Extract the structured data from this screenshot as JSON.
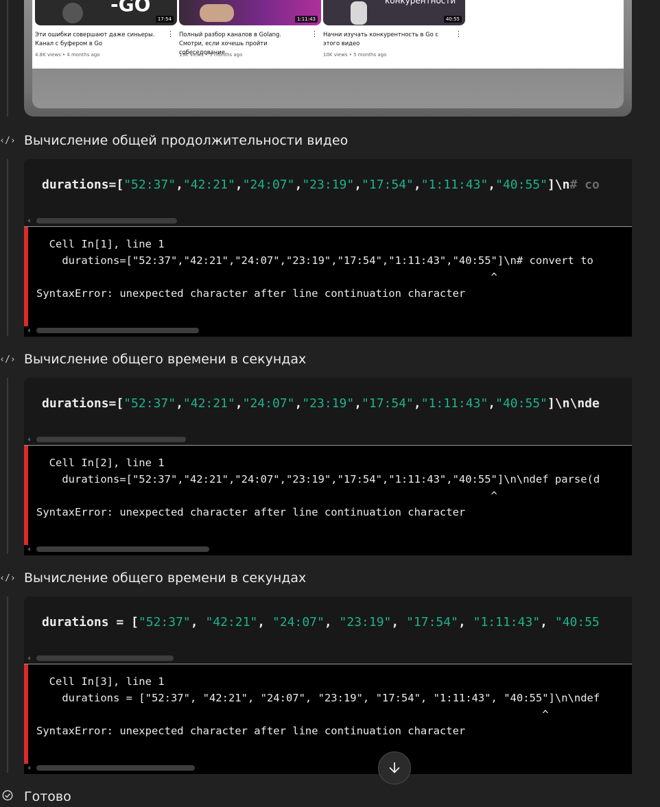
{
  "videos": [
    {
      "title": "Эти ошибки совершают даже синьеры. Канал с буфером в Go",
      "meta": "4.8K views • 4 months ago",
      "duration": "17:54",
      "thumb_text": "-GO"
    },
    {
      "title": "Полный разбор каналов в Golang. Смотри, если хочешь пройти собеседование",
      "meta": "19K views • 5 months ago",
      "duration": "1:11:43",
      "thumb_text": ""
    },
    {
      "title": "Начни изучать конкурентность в Go с этого видео",
      "meta": "10K views • 5 months ago",
      "duration": "40:55",
      "thumb_text": "конкурентности"
    }
  ],
  "steps": [
    {
      "label": "Вычисление общей продолжительности видео",
      "code": {
        "head": "durations=[",
        "strings": [
          "\"52:37\"",
          "\"42:21\"",
          "\"24:07\"",
          "\"23:19\"",
          "\"17:54\"",
          "\"1:11:43\"",
          "\"40:55\""
        ],
        "sep": ",",
        "tail": "]\\n",
        "tail_dim": "# co"
      },
      "output": {
        "line1": "  Cell In[1], line 1",
        "line2": "    durations=[\"52:37\",\"42:21\",\"24:07\",\"23:19\",\"17:54\",\"1:11:43\",\"40:55\"]\\n# convert to",
        "caret": "                                                                       ^",
        "error": "SyntaxError: unexpected character after line continuation character"
      }
    },
    {
      "label": "Вычисление общего времени в секундах",
      "code": {
        "head": "durations=[",
        "strings": [
          "\"52:37\"",
          "\"42:21\"",
          "\"24:07\"",
          "\"23:19\"",
          "\"17:54\"",
          "\"1:11:43\"",
          "\"40:55\""
        ],
        "sep": ",",
        "tail": "]\\n\\nde",
        "tail_dim": ""
      },
      "output": {
        "line1": "  Cell In[2], line 1",
        "line2": "    durations=[\"52:37\",\"42:21\",\"24:07\",\"23:19\",\"17:54\",\"1:11:43\",\"40:55\"]\\n\\ndef parse(d",
        "caret": "                                                                       ^",
        "error": "SyntaxError: unexpected character after line continuation character"
      }
    },
    {
      "label": "Вычисление общего времени в секундах",
      "code": {
        "head": "durations = [",
        "strings": [
          "\"52:37\"",
          "\"42:21\"",
          "\"24:07\"",
          "\"23:19\"",
          "\"17:54\"",
          "\"1:11:43\"",
          "\"40:55"
        ],
        "sep": ", ",
        "tail": "",
        "tail_dim": ""
      },
      "output": {
        "line1": "  Cell In[3], line 1",
        "line2": "    durations = [\"52:37\", \"42:21\", \"24:07\", \"23:19\", \"17:54\", \"1:11:43\", \"40:55\"]\\n\\ndef",
        "caret": "                                                                               ^",
        "error": "SyntaxError: unexpected character after line continuation character"
      }
    }
  ],
  "done_label": "Готово",
  "icons": {
    "step": "code-icon",
    "done": "check-circle-icon",
    "scroll": "arrow-down-icon"
  },
  "colors": {
    "string": "#1db28b",
    "error_bar": "#d92b2b",
    "background": "#212121"
  }
}
